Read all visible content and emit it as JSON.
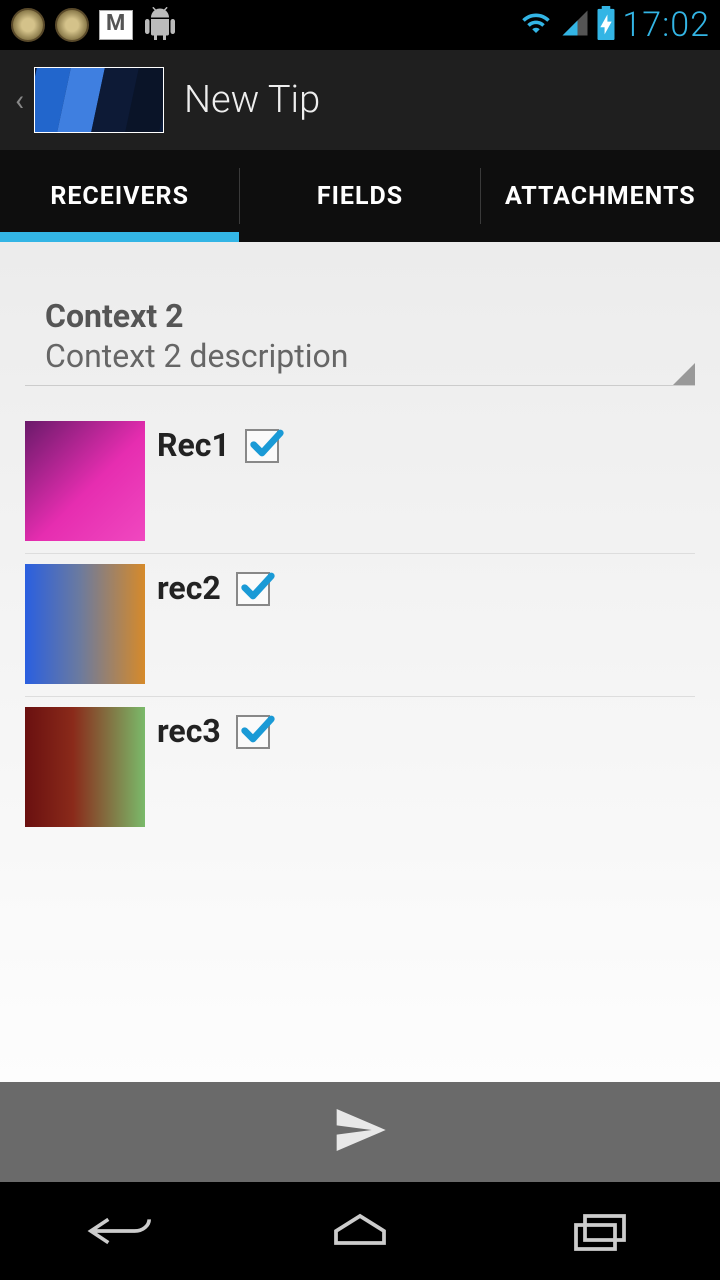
{
  "status": {
    "time": "17:02"
  },
  "header": {
    "title": "New Tip"
  },
  "tabs": [
    {
      "label": "RECEIVERS",
      "active": true
    },
    {
      "label": "FIELDS",
      "active": false
    },
    {
      "label": "ATTACHMENTS",
      "active": false
    }
  ],
  "context": {
    "title": "Context 2",
    "description": "Context 2 description"
  },
  "receivers": [
    {
      "name": "Rec1",
      "checked": true
    },
    {
      "name": "rec2",
      "checked": true
    },
    {
      "name": "rec3",
      "checked": true
    }
  ]
}
